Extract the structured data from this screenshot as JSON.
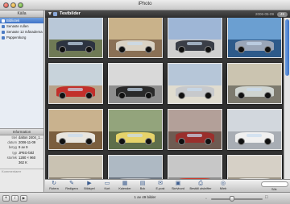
{
  "window": {
    "title": "iPhoto"
  },
  "source_pane": {
    "header": "Källa",
    "items": [
      {
        "label": "Bibliotek",
        "selected": true
      },
      {
        "label": "Senaste rullen",
        "selected": false
      },
      {
        "label": "Senaste 12 månaderna",
        "selected": false
      },
      {
        "label": "Papperskorg",
        "selected": false
      }
    ]
  },
  "info_pane": {
    "header": "Information",
    "rows": [
      {
        "key": "titel",
        "value": "dalton 2404_1..."
      },
      {
        "key": "datum",
        "value": "2006-11-09"
      },
      {
        "key": "betyg",
        "value": "9 av 9"
      },
      {
        "key": "typ",
        "value": "JPEG-bild"
      },
      {
        "key": "storlek",
        "value": "1280 × 960"
      },
      {
        "key": "",
        "value": "362 K"
      }
    ],
    "comment_placeholder": "Kommentarer"
  },
  "roll": {
    "title": "Testbilder",
    "date": "2006-05-09",
    "count": "49"
  },
  "thumbnails": [
    {
      "sky": "#b9c8d8",
      "ground": "#6f7a55",
      "car": "#2c3340"
    },
    {
      "sky": "#c9b28a",
      "ground": "#8a7055",
      "car": "#d9d2c4"
    },
    {
      "sky": "#9eb6d6",
      "ground": "#cfcfcf",
      "car": "#3a3e47"
    },
    {
      "sky": "#6b9fd1",
      "ground": "#2d5a8a",
      "car": "#9aa6b8"
    },
    {
      "sky": "#c8d3db",
      "ground": "#b7a28a",
      "car": "#c2302b"
    },
    {
      "sky": "#d9d9d9",
      "ground": "#8e8e8e",
      "car": "#2a2a2a"
    },
    {
      "sky": "#b6c6d8",
      "ground": "#e0dccf",
      "car": "#c7c9cc"
    },
    {
      "sky": "#cbc4b0",
      "ground": "#7d7a6e",
      "car": "#cfd4d0"
    },
    {
      "sky": "#c9b28e",
      "ground": "#7a5e3e",
      "car": "#e8e5de"
    },
    {
      "sky": "#93a47c",
      "ground": "#5e6e4a",
      "car": "#e6d36a"
    },
    {
      "sky": "#b3a099",
      "ground": "#6e5b52",
      "car": "#9a2f2c"
    },
    {
      "sky": "#d2d7dd",
      "ground": "#a8adb4",
      "car": "#f0f0f0"
    },
    {
      "sky": "#c9c2b2",
      "ground": "#8d8576",
      "car": "#dcd7cc"
    },
    {
      "sky": "#aeb9c3",
      "ground": "#6d7681",
      "car": "#b7bcc1"
    },
    {
      "sky": "#c7c7c7",
      "ground": "#8f8f8f",
      "car": "#cf3a2a"
    },
    {
      "sky": "#d6d0c6",
      "ground": "#9c9486",
      "car": "#e0dfdc"
    }
  ],
  "toolbar": {
    "tools": [
      {
        "label": "Rotera",
        "glyph": "↻"
      },
      {
        "label": "Redigera",
        "glyph": "✎"
      },
      {
        "label": "Bildspel",
        "glyph": "▶"
      },
      {
        "label": "Kort",
        "glyph": "▭"
      },
      {
        "label": "Kalender",
        "glyph": "▦"
      },
      {
        "label": "Bok",
        "glyph": "▤"
      },
      {
        "label": "E-post",
        "glyph": "✉"
      },
      {
        "label": "Skrivbord",
        "glyph": "▣"
      },
      {
        "label": "Beställ utskrifter",
        "glyph": "⎙"
      },
      {
        "label": "iWeb",
        "glyph": "◎"
      }
    ],
    "search_placeholder": "",
    "search_label": "Sök"
  },
  "status": {
    "photo_count": "1 av 49 bilder",
    "add_glyph": "+",
    "info_glyph": "i",
    "play_glyph": "▶",
    "thumb_size_percent": 40
  }
}
